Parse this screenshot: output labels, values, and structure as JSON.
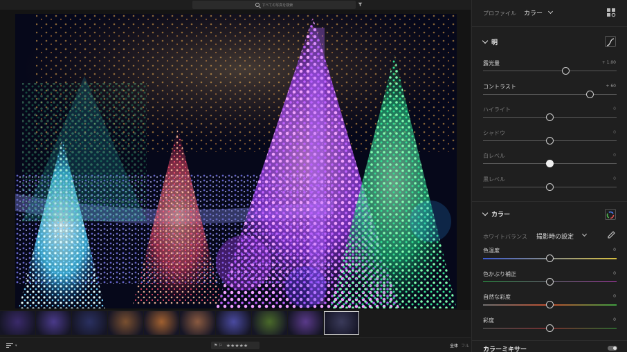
{
  "search": {
    "placeholder": "すべての写真を検索"
  },
  "bottom_bar": {
    "view_fit": "全体",
    "view_full": "フル",
    "rating_stars": "★★★★★"
  },
  "filmstrip": {
    "count": 10,
    "selected_index": 9,
    "thumb_colors": [
      "#3a2a6a",
      "#4a3a8a",
      "#2a3060",
      "#7a5030",
      "#a06030",
      "#8a5a40",
      "#4a4aa0",
      "#4a6a2a",
      "#5a3a8a",
      "#3a3a5a"
    ]
  },
  "profile": {
    "label": "プロファイル",
    "value": "カラー"
  },
  "light": {
    "title": "明",
    "sliders": [
      {
        "label": "露光量",
        "value": "+ 1.00",
        "level": 0.62,
        "dim": false
      },
      {
        "label": "コントラスト",
        "value": "+ 60",
        "level": 0.8,
        "dim": false
      },
      {
        "label": "ハイライト",
        "value": "0",
        "level": 0.5,
        "dim": true
      },
      {
        "label": "シャドウ",
        "value": "0",
        "level": 0.5,
        "dim": true
      },
      {
        "label": "白レベル",
        "value": "0",
        "level": 0.5,
        "dim": true,
        "active": true
      },
      {
        "label": "黒レベル",
        "value": "0",
        "level": 0.5,
        "dim": true
      }
    ]
  },
  "color": {
    "title": "カラー",
    "wb_label": "ホワイトバランス",
    "wb_value": "撮影時の設定",
    "sliders": [
      {
        "label": "色温度",
        "value": "0",
        "level": 0.5
      },
      {
        "label": "色かぶり補正",
        "value": "0",
        "level": 0.5
      },
      {
        "label": "自然な彩度",
        "value": "0",
        "level": 0.5
      },
      {
        "label": "彩度",
        "value": "0",
        "level": 0.5
      }
    ]
  },
  "color_mixer": {
    "title": "カラーミキサー"
  },
  "icons": {
    "search": "search-icon",
    "filter": "filter-icon",
    "profile_browser": "profile-browser-icon",
    "tone_curve": "tone-curve-icon",
    "color_wheel": "color-wheel-icon",
    "eyedropper": "eyedropper-icon",
    "toggle": "toggle-icon"
  }
}
